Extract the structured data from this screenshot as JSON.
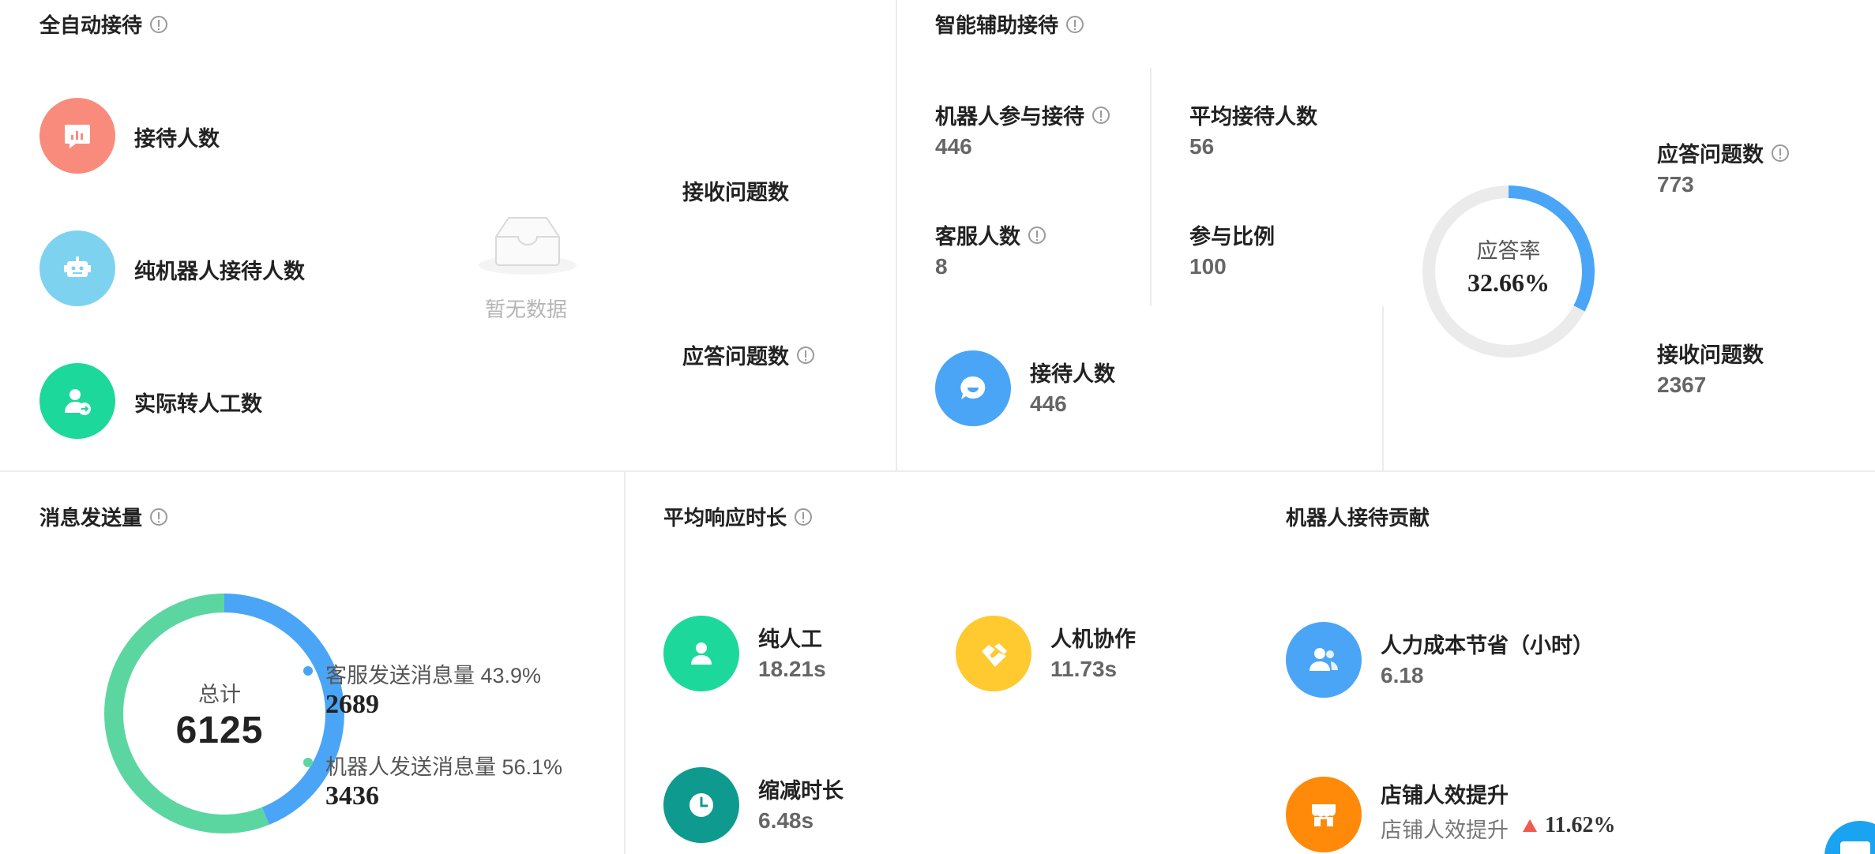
{
  "auto_reception": {
    "title": "全自动接待",
    "items": [
      {
        "label": "接待人数",
        "icon": "chart-bubble-icon",
        "color": "#f98b7d"
      },
      {
        "label": "纯机器人接待人数",
        "icon": "robot-icon",
        "color": "#7dd3ef"
      },
      {
        "label": "实际转人工数",
        "icon": "user-transfer-icon",
        "color": "#1dd89b"
      }
    ],
    "empty_text": "暂无数据",
    "received_questions_label": "接收问题数",
    "answered_questions_label": "应答问题数"
  },
  "smart_assist": {
    "title": "智能辅助接待",
    "robot_participation": {
      "label": "机器人参与接待",
      "value": "446"
    },
    "avg_reception": {
      "label": "平均接待人数",
      "value": "56"
    },
    "agent_count": {
      "label": "客服人数",
      "value": "8"
    },
    "participation_ratio": {
      "label": "参与比例",
      "value": "100"
    },
    "reception": {
      "label": "接待人数",
      "value": "446",
      "color": "#4aa5f7"
    },
    "answer_rate": {
      "label": "应答率",
      "value": "32.66%",
      "fraction": 0.3266,
      "color": "#4aa5f7",
      "track_color": "#ebebeb"
    },
    "answered": {
      "label": "应答问题数",
      "value": "773"
    },
    "received": {
      "label": "接收问题数",
      "value": "2367"
    }
  },
  "messages": {
    "title": "消息发送量",
    "total_label": "总计",
    "total_value": "6125",
    "series": [
      {
        "name": "客服发送消息量 43.9%",
        "value": "2689",
        "fraction": 0.439,
        "color": "#4aa5f7"
      },
      {
        "name": "机器人发送消息量 56.1%",
        "value": "3436",
        "fraction": 0.561,
        "color": "#5cd6a1"
      }
    ]
  },
  "response_time": {
    "title": "平均响应时长",
    "items": [
      {
        "label": "纯人工",
        "value": "18.21s",
        "color": "#1dd89b",
        "icon": "person-icon"
      },
      {
        "label": "人机协作",
        "value": "11.73s",
        "color": "#ffc930",
        "icon": "handshake-icon"
      },
      {
        "label": "缩减时长",
        "value": "6.48s",
        "color": "#0f9a8f",
        "icon": "clock-icon"
      }
    ]
  },
  "robot_contribution": {
    "title": "机器人接待贡献",
    "labor_saving": {
      "label": "人力成本节省（小时）",
      "value": "6.18",
      "color": "#4aa5f7",
      "icon": "people-icon"
    },
    "store_efficiency": {
      "label": "店铺人效提升",
      "sub_label": "店铺人效提升",
      "value": "11.62%",
      "color": "#ff8a0a",
      "icon": "store-icon",
      "up_color": "#f05a4f"
    }
  }
}
